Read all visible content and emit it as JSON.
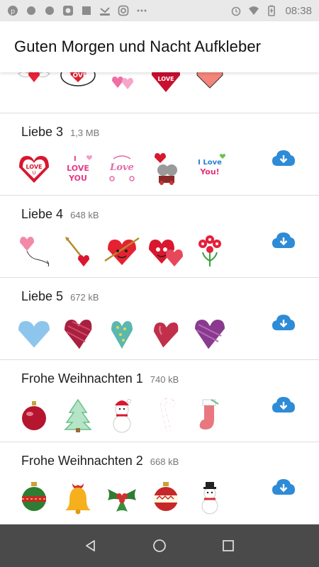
{
  "status_bar": {
    "time": "08:38",
    "left_icons": [
      "pinterest-icon",
      "dot-icon",
      "dot-icon",
      "gallery-icon",
      "square-icon",
      "missed-call-icon",
      "instagram-icon",
      "more-icon"
    ],
    "right_icons": [
      "alarm-icon",
      "wifi-icon",
      "battery-icon"
    ]
  },
  "app": {
    "title": "Guten Morgen und Nacht Aufkleber"
  },
  "packs": [
    {
      "name": "",
      "size": "",
      "stickers": [
        "winged-heart-sticker",
        "love-cloud-sticker",
        "love-letters-sticker",
        "love-heart-couple-sticker",
        "pink-heart-sticker"
      ]
    },
    {
      "name": "Liebe 3",
      "size": "1,3 MB",
      "stickers": [
        "love-u-heart-sticker",
        "i-love-you-sticker",
        "love-lettering-sticker",
        "teddy-bears-sticker",
        "i-love-you-colorful-sticker"
      ]
    },
    {
      "name": "Liebe 4",
      "size": "648 kB",
      "stickers": [
        "heart-balloon-sticker",
        "cupid-arrow-sticker",
        "heart-arrow-sticker",
        "smiling-hearts-sticker",
        "red-flowers-sticker"
      ]
    },
    {
      "name": "Liebe 5",
      "size": "672 kB",
      "stickers": [
        "blue-heart-sticker",
        "striped-heart-sticker",
        "dotted-teal-heart-sticker",
        "pink-heart-sticker",
        "purple-heart-sticker"
      ]
    },
    {
      "name": "Frohe Weihnachten 1",
      "size": "740 kB",
      "stickers": [
        "ornament-sticker",
        "christmas-tree-sticker",
        "snowman-sticker",
        "candy-cane-sticker",
        "stocking-sticker"
      ]
    },
    {
      "name": "Frohe Weihnachten 2",
      "size": "668 kB",
      "stickers": [
        "green-ornament-sticker",
        "bell-sticker",
        "holly-sticker",
        "red-ornament-sticker",
        "snowman-hat-sticker"
      ]
    }
  ],
  "colors": {
    "download": "#2e8bd6",
    "nav_bar": "#4a4a4a",
    "status_bar": "#e9e9e9"
  },
  "nav": {
    "icons": [
      "back-icon",
      "home-icon",
      "recents-icon"
    ]
  }
}
